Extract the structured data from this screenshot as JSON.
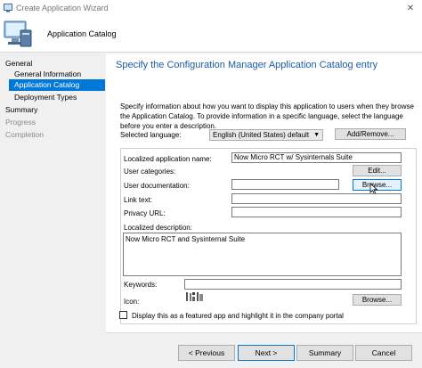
{
  "window": {
    "title": "Create Application Wizard"
  },
  "header": {
    "title": "Application Catalog"
  },
  "nav": {
    "items": [
      {
        "label": "General",
        "state": "normal"
      },
      {
        "label": "General Information",
        "state": "normal"
      },
      {
        "label": "Application Catalog",
        "state": "selected"
      },
      {
        "label": "Deployment Types",
        "state": "normal"
      },
      {
        "label": "Summary",
        "state": "normal"
      },
      {
        "label": "Progress",
        "state": "disabled"
      },
      {
        "label": "Completion",
        "state": "disabled"
      }
    ]
  },
  "content": {
    "title": "Specify the Configuration Manager Application Catalog entry",
    "description": "Specify information about how you want to display this application to users when they browse the Application Catalog. To provide information in a specific language, select the language before you enter a description.",
    "selected_language_label": "Selected language:",
    "selected_language_value": "English (United States) default",
    "add_remove_label": "Add/Remove...",
    "localized_name_label": "Localized application name:",
    "localized_name_value": "Now Micro RCT w/ Sysinternals Suite",
    "user_categories_label": "User categories:",
    "edit_label": "Edit...",
    "user_documentation_label": "User documentation:",
    "browse_doc_label": "Browse...",
    "link_text_label": "Link text:",
    "privacy_url_label": "Privacy URL:",
    "localized_description_label": "Localized description:",
    "localized_description_value": "Now Micro RCT and Sysinternal Suite",
    "keywords_label": "Keywords:",
    "icon_label": "Icon:",
    "browse_icon_label": "Browse...",
    "featured_label": "Display this as a featured app and highlight it in the company portal"
  },
  "footer": {
    "previous_label": "< Previous",
    "next_label": "Next >",
    "summary_label": "Summary",
    "cancel_label": "Cancel"
  },
  "colors": {
    "accent": "#0078d7",
    "title_blue": "#1c5ba0"
  }
}
